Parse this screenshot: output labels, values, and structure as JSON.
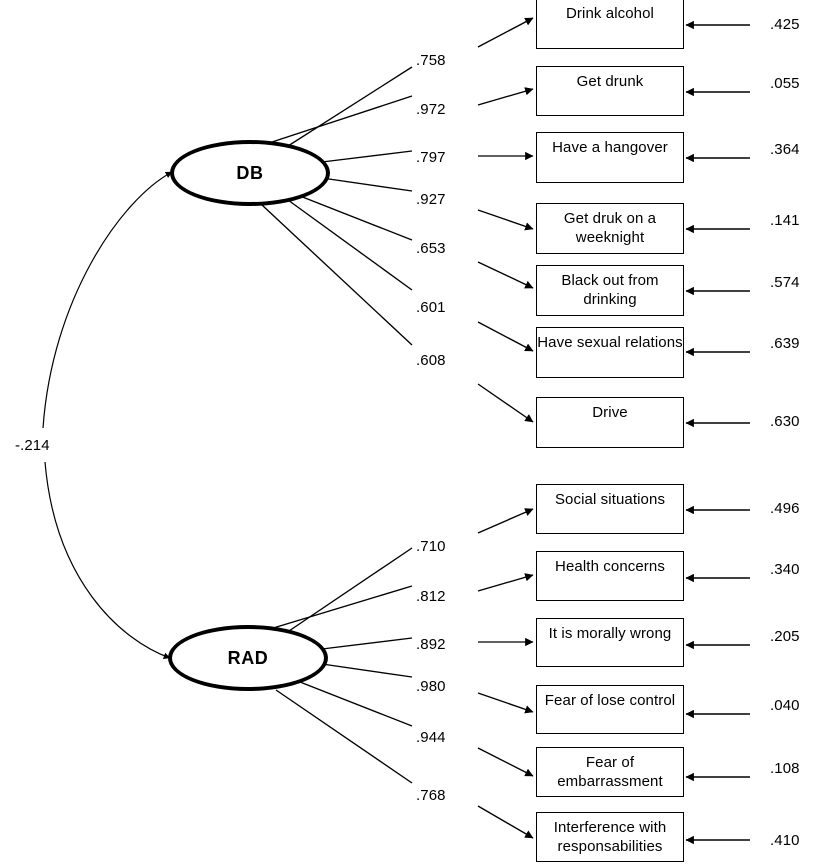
{
  "diagram": {
    "type": "structural-equation-model-path-diagram",
    "correlation": {
      "label": "-.214",
      "between": [
        "DB",
        "RAD"
      ]
    },
    "latents": [
      {
        "id": "DB",
        "label": "DB"
      },
      {
        "id": "RAD",
        "label": "RAD"
      }
    ],
    "db_indicators": [
      {
        "label": "Drink alcohol",
        "loading": ".758",
        "residual": ".425"
      },
      {
        "label": "Get drunk",
        "loading": ".972",
        "residual": ".055"
      },
      {
        "label": "Have a hangover",
        "loading": ".797",
        "residual": ".364"
      },
      {
        "label": "Get druk on a weeknight",
        "loading": ".927",
        "residual": ".141"
      },
      {
        "label": "Black out from drinking",
        "loading": ".653",
        "residual": ".574"
      },
      {
        "label": "Have sexual relations",
        "loading": ".601",
        "residual": ".639"
      },
      {
        "label": "Drive",
        "loading": ".608",
        "residual": ".630"
      }
    ],
    "rad_indicators": [
      {
        "label": "Social situations",
        "loading": ".710",
        "residual": ".496"
      },
      {
        "label": "Health concerns",
        "loading": ".812",
        "residual": ".340"
      },
      {
        "label": "It is morally wrong",
        "loading": ".892",
        "residual": ".205"
      },
      {
        "label": "Fear of lose control",
        "loading": ".980",
        "residual": ".040"
      },
      {
        "label": "Fear of embarrassment",
        "loading": ".944",
        "residual": ".108"
      },
      {
        "label": "Interference  with responsabilities",
        "loading": ".768",
        "residual": ".410"
      }
    ],
    "colors": {
      "stroke": "#000000",
      "background": "#ffffff",
      "text": "#000000"
    }
  },
  "chart_data": {
    "type": "diagram",
    "title": "",
    "notes": "Confirmatory factor analysis path diagram with two correlated latent factors (DB, RAD), seven and six observed indicators respectively, standardized loadings and residual variances.",
    "series": [
      {
        "name": "DB",
        "categories": [
          "Drink alcohol",
          "Get drunk",
          "Have a hangover",
          "Get druk on a weeknight",
          "Black out from drinking",
          "Have sexual relations",
          "Drive"
        ],
        "loadings": [
          0.758,
          0.972,
          0.797,
          0.927,
          0.653,
          0.601,
          0.608
        ],
        "residuals": [
          0.425,
          0.055,
          0.364,
          0.141,
          0.574,
          0.639,
          0.63
        ]
      },
      {
        "name": "RAD",
        "categories": [
          "Social situations",
          "Health concerns",
          "It is morally wrong",
          "Fear of lose control",
          "Fear of embarrassment",
          "Interference  with responsabilities"
        ],
        "loadings": [
          0.71,
          0.812,
          0.892,
          0.98,
          0.944,
          0.768
        ],
        "residuals": [
          0.496,
          0.34,
          0.205,
          0.04,
          0.108,
          0.41
        ]
      }
    ],
    "factor_correlation": -0.214
  }
}
